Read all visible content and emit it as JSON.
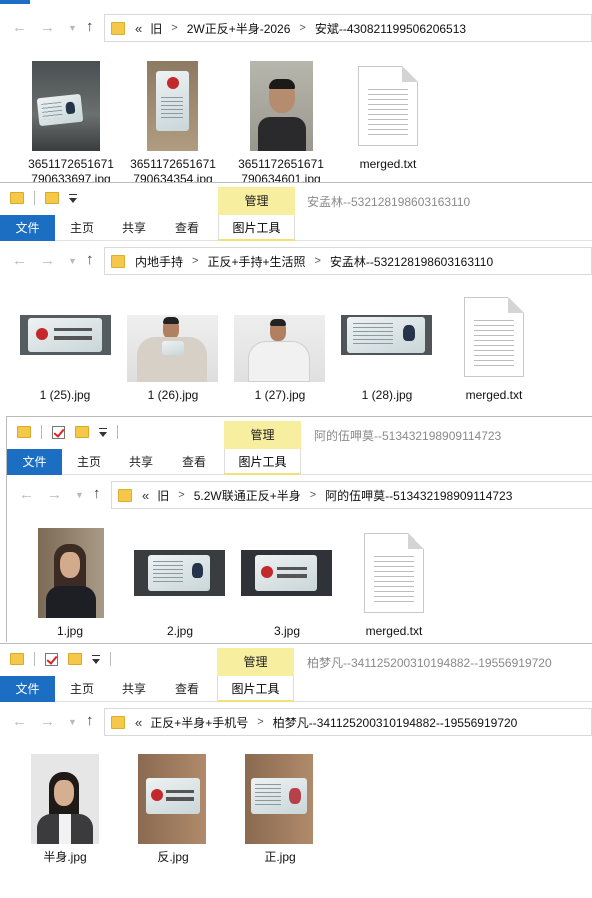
{
  "window1": {
    "path": [
      "旧",
      "2W正反+半身-2026",
      "安斌--430821199506206513"
    ],
    "files": [
      {
        "name": "3651172651671790633697.jpg",
        "display": "3651172651671\n790633697.jpg"
      },
      {
        "name": "3651172651671790634354.jpg",
        "display": "3651172651671\n790634354.jpg"
      },
      {
        "name": "3651172651671790634601.jpg",
        "display": "3651172651671\n790634601.jpg"
      },
      {
        "name": "merged.txt",
        "display": "merged.txt"
      }
    ]
  },
  "window2": {
    "title": "安孟林--532128198603163110",
    "manage": "管理",
    "tabs": {
      "file": "文件",
      "home": "主页",
      "share": "共享",
      "view": "查看",
      "tools": "图片工具"
    },
    "path": [
      "内地手持",
      "正反+手持+生活照",
      "安孟林--532128198603163110"
    ],
    "files": [
      "1 (25).jpg",
      "1 (26).jpg",
      "1 (27).jpg",
      "1 (28).jpg",
      "merged.txt"
    ]
  },
  "window3": {
    "title": "阿的伍呷莫--513432198909114723",
    "manage": "管理",
    "tabs": {
      "file": "文件",
      "home": "主页",
      "share": "共享",
      "view": "查看",
      "tools": "图片工具"
    },
    "path": [
      "旧",
      "5.2W联通正反+半身",
      "阿的伍呷莫--513432198909114723"
    ],
    "files": [
      "1.jpg",
      "2.jpg",
      "3.jpg",
      "merged.txt"
    ]
  },
  "window4": {
    "title": "柏梦凡--341125200310194882--19556919720",
    "manage": "管理",
    "tabs": {
      "file": "文件",
      "home": "主页",
      "share": "共享",
      "view": "查看",
      "tools": "图片工具"
    },
    "path": [
      "正反+半身+手机号",
      "柏梦凡--341125200310194882--19556919720"
    ],
    "files": [
      "半身.jpg",
      "反.jpg",
      "正.jpg"
    ]
  },
  "colors": {
    "accent": "#1b6ec2",
    "manage_bg": "#f7eea0",
    "folder": "#f5c84a"
  }
}
